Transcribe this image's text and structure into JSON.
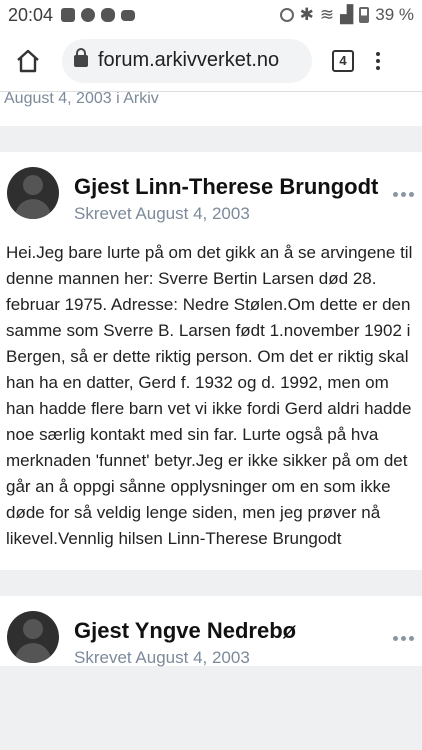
{
  "status_bar": {
    "time": "20:04",
    "battery": "39 %"
  },
  "browser": {
    "url": "forum.arkivverket.no",
    "tab_count": "4"
  },
  "previous_post": {
    "meta": "August 4, 2003 i Arkiv"
  },
  "posts": [
    {
      "author": "Gjest Linn-Therese Brungodt",
      "date": "Skrevet August 4, 2003",
      "body": "Hei.Jeg bare lurte på om det gikk an å se arvingene til denne mannen her: Sverre Bertin Larsen død 28. februar 1975. Adresse: Nedre Stølen.Om dette er den samme som Sverre B. Larsen født 1.november 1902 i Bergen, så er dette riktig person. Om det er riktig skal han ha en datter, Gerd f. 1932 og d. 1992, men om han hadde flere barn vet vi ikke fordi Gerd aldri hadde noe særlig kontakt med sin far. Lurte også på hva merknaden 'funnet' betyr.Jeg er ikke sikker på om det går an å oppgi sånne opplysninger om en som ikke døde for så veldig lenge siden, men jeg prøver nå likevel.Vennlig hilsen Linn-Therese Brungodt"
    },
    {
      "author": "Gjest Yngve Nedrebø",
      "date": "Skrevet August 4, 2003"
    }
  ]
}
